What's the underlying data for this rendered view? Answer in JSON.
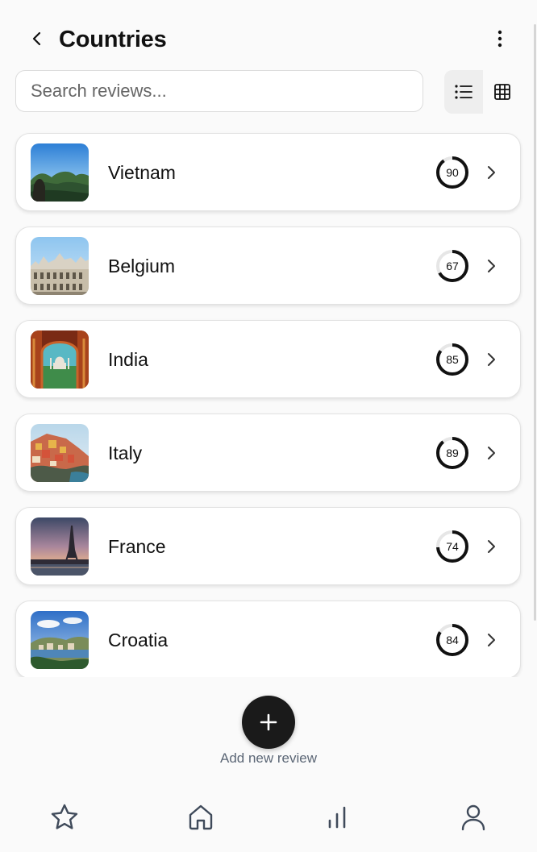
{
  "header": {
    "title": "Countries",
    "back_icon": "chevron-left-icon",
    "more_icon": "more-vertical-icon"
  },
  "search": {
    "placeholder": "Search reviews...",
    "value": ""
  },
  "view_toggle": {
    "options": [
      {
        "name": "list-view",
        "icon": "list-icon",
        "active": true
      },
      {
        "name": "grid-view",
        "icon": "grid-icon",
        "active": false
      }
    ]
  },
  "countries": [
    {
      "name": "Vietnam",
      "score": 90
    },
    {
      "name": "Belgium",
      "score": 67
    },
    {
      "name": "India",
      "score": 85
    },
    {
      "name": "Italy",
      "score": 89
    },
    {
      "name": "France",
      "score": 74
    },
    {
      "name": "Croatia",
      "score": 84
    }
  ],
  "fab": {
    "label": "Add new review",
    "icon": "plus-icon"
  },
  "bottom_nav": {
    "items": [
      {
        "icon": "star-icon"
      },
      {
        "icon": "home-icon"
      },
      {
        "icon": "bar-chart-icon"
      },
      {
        "icon": "user-icon"
      }
    ]
  },
  "colors": {
    "accent": "#1a1a1a",
    "background": "#fafafa",
    "card": "#ffffff",
    "ring_track": "#e6e6e6",
    "ring": "#111111",
    "muted_text": "#5b6675"
  }
}
